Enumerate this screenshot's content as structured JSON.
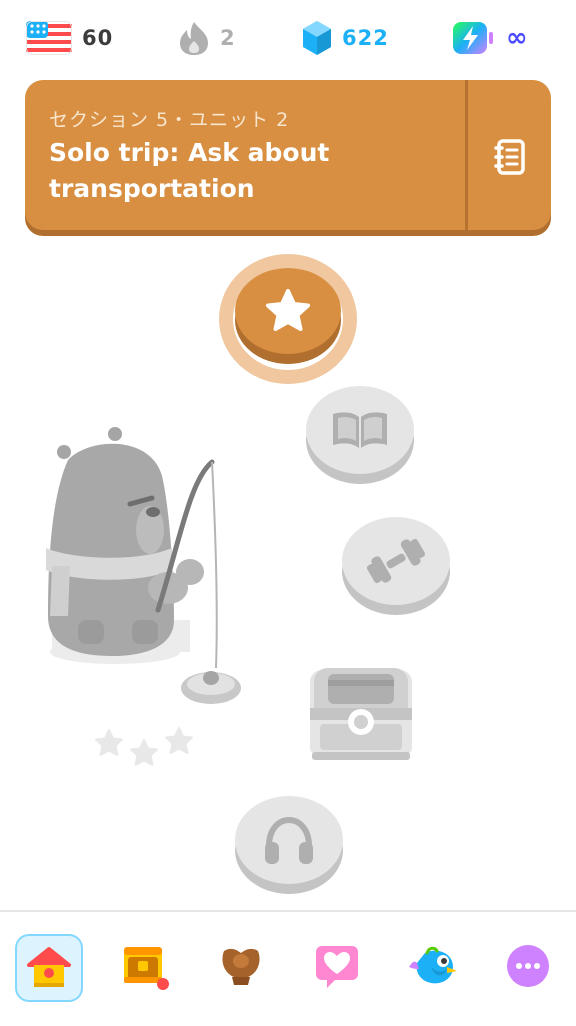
{
  "stats": {
    "language": {
      "icon": "us-flag-icon",
      "value": "60"
    },
    "streak": {
      "icon": "flame-icon",
      "value": "2"
    },
    "gems": {
      "icon": "gem-icon",
      "value": "622"
    },
    "energy": {
      "icon": "energy-battery-icon",
      "value": "∞"
    }
  },
  "banner": {
    "subtitle": "セクション 5・ユニット 2",
    "title": "Solo trip: Ask about transportation",
    "guide_icon": "notebook-icon",
    "color": "#d88f42"
  },
  "path": {
    "nodes": [
      {
        "icon": "star-icon",
        "state": "current"
      },
      {
        "icon": "book-icon",
        "state": "locked"
      },
      {
        "icon": "dumbbell-icon",
        "state": "locked"
      },
      {
        "icon": "treasure-chest-icon",
        "state": "locked"
      },
      {
        "icon": "headphones-icon",
        "state": "locked"
      }
    ],
    "mascot": "bear-fishing-illustration",
    "stars": 3
  },
  "nav": {
    "items": [
      {
        "icon": "home-icon",
        "active": true
      },
      {
        "icon": "quests-chest-icon",
        "badge": true
      },
      {
        "icon": "leaderboard-shield-icon"
      },
      {
        "icon": "heart-practice-icon"
      },
      {
        "icon": "shop-bird-icon"
      },
      {
        "icon": "more-icon"
      }
    ]
  }
}
